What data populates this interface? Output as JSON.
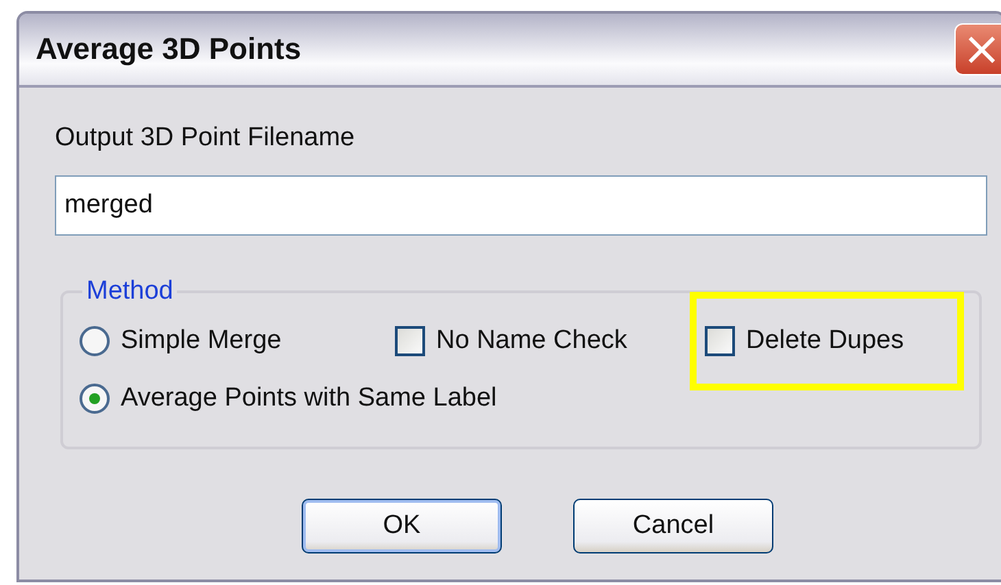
{
  "window": {
    "title": "Average 3D Points",
    "close": "×"
  },
  "filename": {
    "label": "Output 3D Point Filename",
    "value": "merged"
  },
  "method": {
    "title": "Method",
    "rows": [
      [
        {
          "kind": "radio",
          "label": "Simple Merge",
          "selected": false,
          "highlighted": false
        },
        {
          "kind": "checkbox",
          "label": "No Name Check",
          "checked": false,
          "highlighted": false
        },
        {
          "kind": "checkbox",
          "label": "Delete Dupes",
          "checked": false,
          "highlighted": true
        }
      ],
      [
        {
          "kind": "radio",
          "label": "Average Points with Same Label",
          "selected": true,
          "highlighted": false
        }
      ]
    ]
  },
  "buttons": [
    {
      "label": "OK",
      "default": true
    },
    {
      "label": "Cancel",
      "default": false
    }
  ]
}
